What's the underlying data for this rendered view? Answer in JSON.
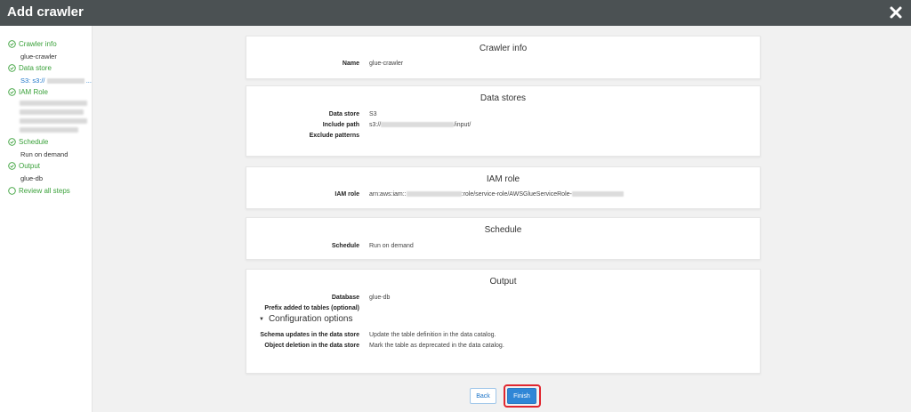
{
  "window": {
    "title": "Add crawler",
    "close_icon": "close-icon"
  },
  "sidebar": {
    "steps": [
      {
        "label": "Crawler info",
        "value": "glue-crawler"
      },
      {
        "label": "Data store",
        "value": "S3: s3://"
      },
      {
        "label": "IAM Role"
      },
      {
        "label": "Schedule",
        "value": "Run on demand"
      },
      {
        "label": "Output",
        "value": "glue-db"
      },
      {
        "label": "Review all steps"
      }
    ],
    "ellipsis": "..."
  },
  "panels": {
    "crawler_info": {
      "title": "Crawler info",
      "name_key": "Name",
      "name_value": "glue-crawler"
    },
    "data_stores": {
      "title": "Data stores",
      "store_key": "Data store",
      "store_value": "S3",
      "include_key": "Include path",
      "include_prefix": "s3://",
      "include_suffix": "/input/",
      "exclude_key": "Exclude patterns"
    },
    "iam_role": {
      "title": "IAM role",
      "role_key": "IAM role",
      "role_prefix": "arn:aws:iam::",
      "role_middle": ":role/service-role/AWSGlueServiceRole-"
    },
    "schedule": {
      "title": "Schedule",
      "schedule_key": "Schedule",
      "schedule_value": "Run on demand"
    },
    "output": {
      "title": "Output",
      "database_key": "Database",
      "database_value": "glue-db",
      "prefix_key": "Prefix added to tables (optional)",
      "config_label": "Configuration options",
      "schema_key": "Schema updates in the data store",
      "schema_value": "Update the table definition in the data catalog.",
      "deletion_key": "Object deletion in the data store",
      "deletion_value": "Mark the table as deprecated in the data catalog."
    }
  },
  "buttons": {
    "back": "Back",
    "finish": "Finish"
  },
  "colors": {
    "topbar": "#4b5153",
    "step_green": "#3aa13a",
    "primary": "#2f86d6",
    "highlight": "#e0262f"
  }
}
